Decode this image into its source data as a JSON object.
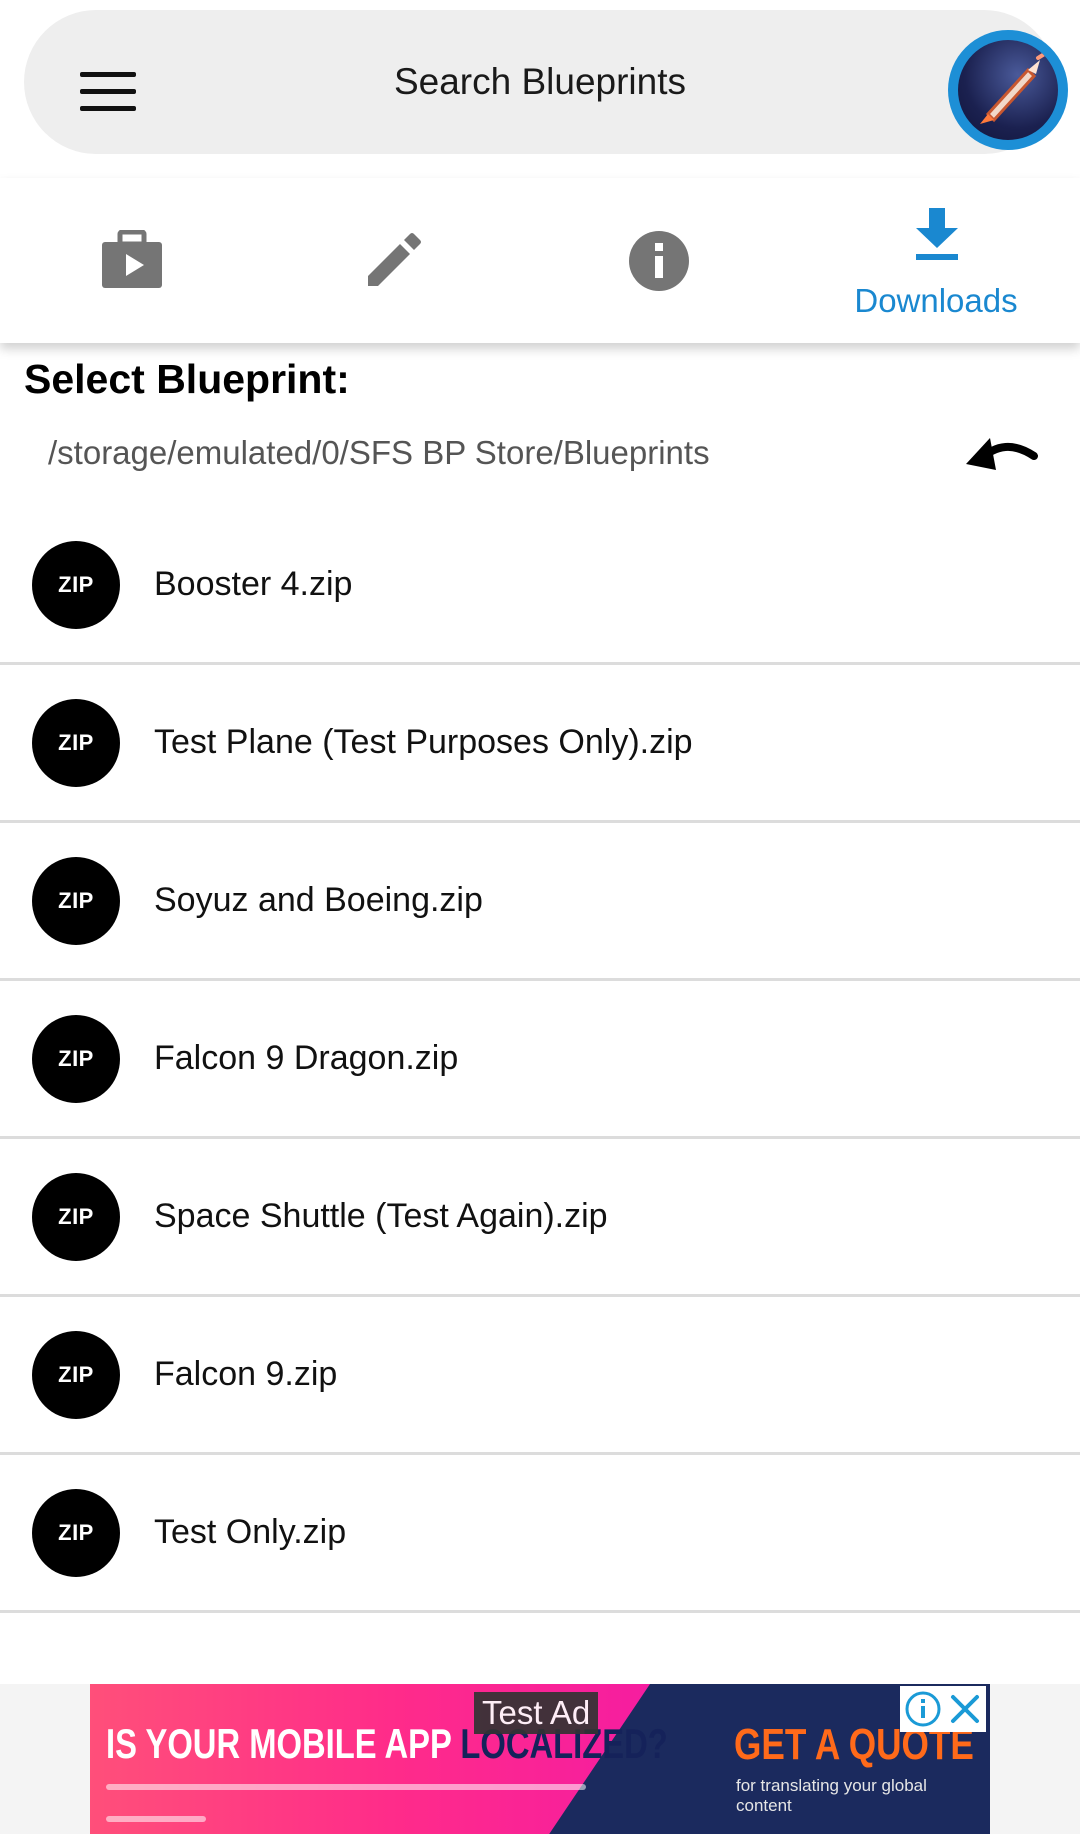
{
  "search_bar": {
    "label": "Search Blueprints"
  },
  "tabs": [
    {
      "name": "play",
      "label": "",
      "icon": "briefcase-play-icon"
    },
    {
      "name": "edit",
      "label": "",
      "icon": "pencil-icon"
    },
    {
      "name": "info",
      "label": "",
      "icon": "info-icon"
    },
    {
      "name": "downloads",
      "label": "Downloads",
      "icon": "download-icon",
      "selected": true
    }
  ],
  "colors": {
    "accent": "#1a88d0",
    "tab_icon": "#757575",
    "zip_badge": "#000000"
  },
  "main": {
    "title": "Select Blueprint:",
    "path": "/storage/emulated/0/SFS BP Store/Blueprints",
    "files": [
      {
        "badge": "ZIP",
        "name": "Booster 4.zip"
      },
      {
        "badge": "ZIP",
        "name": "Test Plane (Test Purposes Only).zip"
      },
      {
        "badge": "ZIP",
        "name": "Soyuz and Boeing.zip"
      },
      {
        "badge": "ZIP",
        "name": "Falcon 9 Dragon.zip"
      },
      {
        "badge": "ZIP",
        "name": "Space Shuttle (Test Again).zip"
      },
      {
        "badge": "ZIP",
        "name": "Falcon 9.zip"
      },
      {
        "badge": "ZIP",
        "name": "Test Only.zip"
      }
    ]
  },
  "ad": {
    "tag": "Test Ad",
    "headline_part1": "IS YOUR MOBILE APP ",
    "headline_part2": "LOCALIZED?",
    "cta": "GET A QUOTE",
    "cta_sub": "for translating your global content"
  }
}
